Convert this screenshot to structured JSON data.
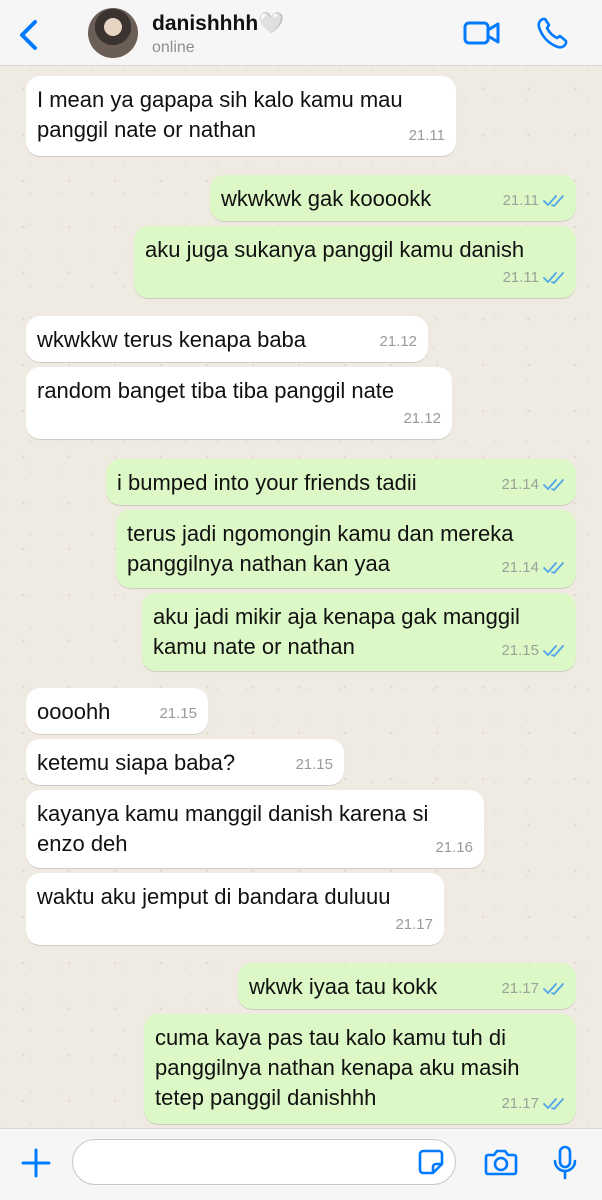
{
  "header": {
    "contact_name": "danishhhh",
    "heart": "🤍",
    "status": "online"
  },
  "colors": {
    "accent": "#007aff",
    "incoming_bubble": "#ffffff",
    "outgoing_bubble": "#dcf8c6",
    "read_tick": "#4fa6e8"
  },
  "messages": [
    {
      "direction": "in",
      "lines": [
        "I mean ya gapapa sih kalo kamu mau",
        "panggil nate or nathan"
      ],
      "time": "21.11"
    },
    {
      "direction": "out",
      "lines": [
        "wkwkwk gak kooookk"
      ],
      "time": "21.11",
      "read": true
    },
    {
      "direction": "out",
      "lines": [
        "aku juga sukanya panggil kamu danish"
      ],
      "time": "21.11",
      "read": true
    },
    {
      "direction": "in",
      "lines": [
        "wkwkkw terus kenapa baba"
      ],
      "time": "21.12"
    },
    {
      "direction": "in",
      "lines": [
        "random banget tiba tiba panggil nate"
      ],
      "time": "21.12"
    },
    {
      "direction": "out",
      "lines": [
        "i bumped into your friends tadii"
      ],
      "time": "21.14",
      "read": true
    },
    {
      "direction": "out",
      "lines": [
        "terus jadi ngomongin kamu dan mereka",
        "panggilnya nathan kan yaa"
      ],
      "time": "21.14",
      "read": true
    },
    {
      "direction": "out",
      "lines": [
        "aku jadi mikir aja kenapa gak manggil",
        "kamu nate or nathan"
      ],
      "time": "21.15",
      "read": true
    },
    {
      "direction": "in",
      "lines": [
        "oooohh"
      ],
      "time": "21.15"
    },
    {
      "direction": "in",
      "lines": [
        "ketemu siapa baba?"
      ],
      "time": "21.15"
    },
    {
      "direction": "in",
      "lines": [
        "kayanya kamu manggil danish karena si",
        "enzo deh"
      ],
      "time": "21.16"
    },
    {
      "direction": "in",
      "lines": [
        "waktu aku jemput di bandara duluuu"
      ],
      "time": "21.17"
    },
    {
      "direction": "out",
      "lines": [
        "wkwk iyaa tau kokk"
      ],
      "time": "21.17",
      "read": true
    },
    {
      "direction": "out",
      "lines": [
        "cuma kaya pas tau kalo kamu tuh di",
        "panggilnya nathan kenapa aku masih",
        "tetep panggil danishhh"
      ],
      "time": "21.17",
      "read": true
    }
  ],
  "composer": {
    "placeholder": ""
  },
  "icons": {
    "back": "chevron-left-icon",
    "video": "video-camera-icon",
    "call": "phone-icon",
    "add": "plus-icon",
    "sticker": "sticker-icon",
    "camera": "camera-icon",
    "mic": "microphone-icon"
  }
}
